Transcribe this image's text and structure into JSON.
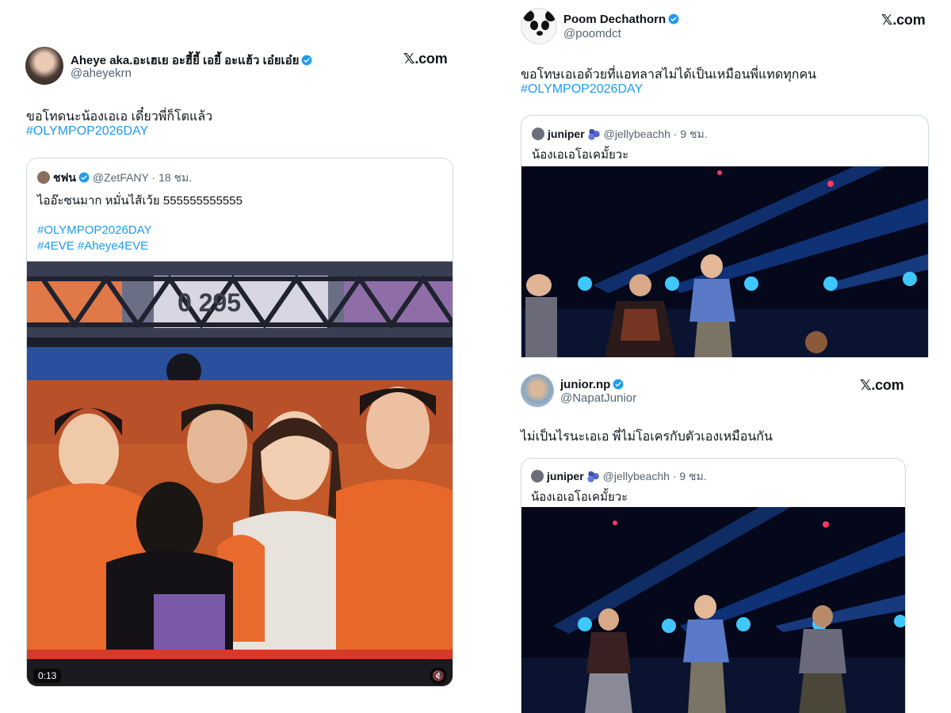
{
  "left_tweet": {
    "name": "Aheye aka.อะเฮเย อะฮี้ยี้ เอยี้ อะแฮ้ว เอ๋ยเอ๋ย",
    "handle": "@aheyekrn",
    "brand": "com",
    "text": "ขอโทดนะน้องเอเอ เดี๋ยวพี่ก็โตแล้ว",
    "hashtag": "#OLYMPOP2026DAY",
    "quote": {
      "name": "ชฟน",
      "handle": "@ZetFANY",
      "time": "· 18 ชม.",
      "text": "ไออ๊ะซนมาก หมั่นไส้เว้ย 555555555555",
      "hashtags": [
        "#OLYMPOP2026DAY",
        "#4EVE #Aheye4EVE"
      ],
      "video_time": "0:13",
      "scoreboard": "0 295"
    }
  },
  "right_top_tweet": {
    "name": "Poom Dechathorn",
    "handle": "@poomdct",
    "brand": "com",
    "text": "ขอโทษเอเอด้วยที่แอทลาสไม่ได้เป็นเหมือนพี่แทดทุกคน",
    "hashtag": "#OLYMPOP2026DAY",
    "quote": {
      "name": "juniper",
      "handle": "@jellybeachh",
      "time": "· 9 ชม.",
      "text": "น้องเอเอโอเคมั้ยวะ"
    }
  },
  "right_bottom_tweet": {
    "name": "junior.np",
    "handle": "@NapatJunior",
    "brand": "com",
    "text": "ไม่เป็นไรนะเอเอ พี่ไม่โอเครกับตัวเองเหมือนกัน",
    "quote": {
      "name": "juniper",
      "handle": "@jellybeachh",
      "time": "· 9 ชม.",
      "text": "น้องเอเอโอเคมั้ยวะ"
    }
  },
  "icons": {
    "verified": "verified-badge-icon",
    "mute": "muted-speaker-icon",
    "x_logo": "x-logo-icon"
  },
  "colors": {
    "link": "#1d9bf0",
    "verified": "#1d9bf0",
    "text": "#0f1419",
    "muted": "#536471"
  }
}
